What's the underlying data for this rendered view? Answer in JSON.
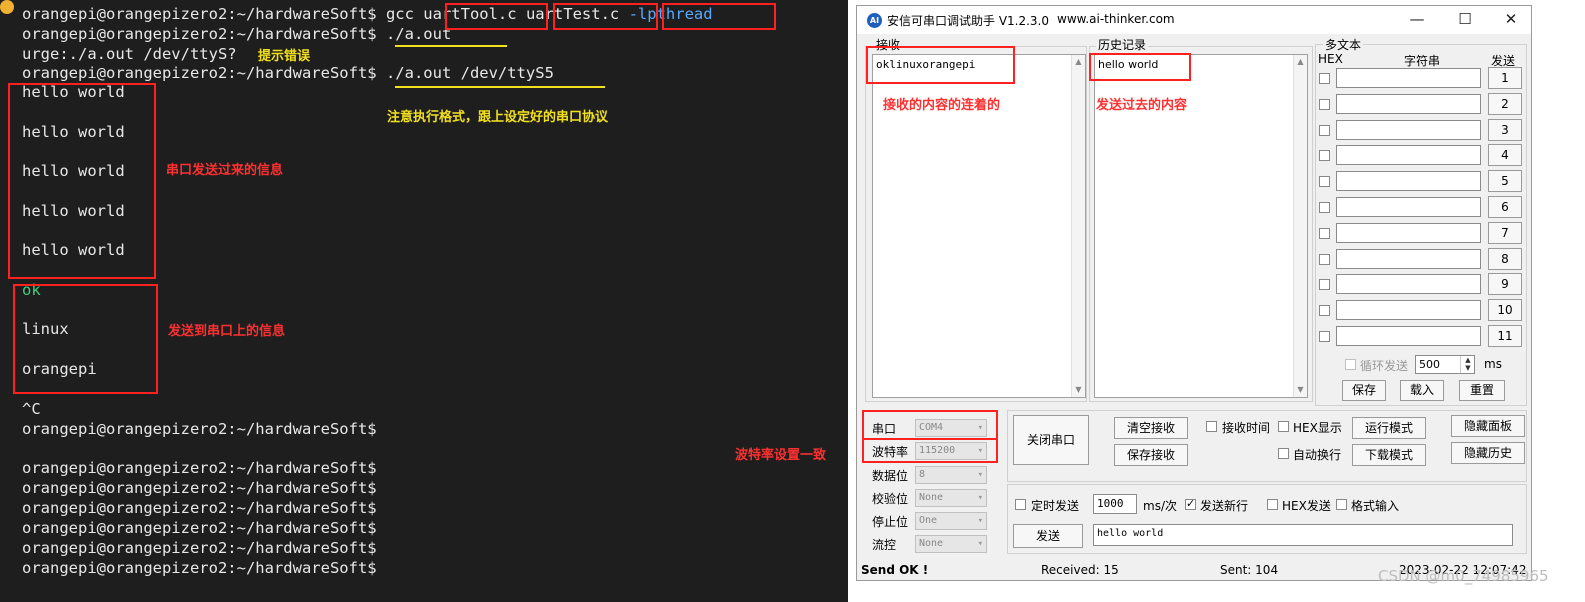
{
  "terminal": {
    "lines": [
      {
        "prompt": "orangepi@orangepizero2:~/hardwareSoft$ ",
        "cmd": "gcc ",
        "a1": "uartTool.c",
        "a2": " uartTest.c",
        "a3": " -lpthread"
      },
      {
        "prompt": "orangepi@orangepizero2:~/hardwareSoft$ ",
        "cmd": "./a.out"
      },
      {
        "text": "urge:./a.out /dev/ttyS?"
      },
      {
        "prompt": "orangepi@orangepizero2:~/hardwareSoft$ ",
        "cmd": "./a.out /dev/ttyS5"
      }
    ],
    "received": [
      "hello world",
      "hello world",
      "hello world",
      "hello world",
      "hello world"
    ],
    "sent": [
      "ok",
      "linux",
      "orangepi"
    ],
    "ctrl_c": "^C",
    "tail_prompts": [
      "orangepi@orangepizero2:~/hardwareSoft$",
      "orangepi@orangepizero2:~/hardwareSoft$",
      "orangepi@orangepizero2:~/hardwareSoft$",
      "orangepi@orangepizero2:~/hardwareSoft$",
      "orangepi@orangepizero2:~/hardwareSoft$",
      "orangepi@orangepizero2:~/hardwareSoft$",
      "orangepi@orangepizero2:~/hardwareSoft$"
    ],
    "annotations": {
      "error_hint": "提示错误",
      "format_note": "注意执行格式，跟上设定好的串口协议",
      "received_note": "串口发送过来的信息",
      "sent_note": "发送到串口上的信息",
      "baud_note": "波特率设置一致"
    }
  },
  "serial_tool": {
    "title": "安信可串口调试助手 V1.2.3.0",
    "url": "www.ai-thinker.com",
    "icon_text": "AI",
    "window_buttons": {
      "minimize": "—",
      "maximize": "☐",
      "close": "✕"
    },
    "receive": {
      "label": "接收",
      "content": "oklinuxorangepi",
      "note": "接收的内容的连着的"
    },
    "history": {
      "label": "历史记录",
      "content": "hello world",
      "note": "发送过去的内容"
    },
    "multitext": {
      "label": "多文本",
      "hex_header": "HEX",
      "string_header": "字符串",
      "send_header": "发送",
      "buttons": [
        "1",
        "2",
        "3",
        "4",
        "5",
        "6",
        "7",
        "8",
        "9",
        "10",
        "11"
      ],
      "loop_send": "循环发送",
      "interval": "500",
      "interval_unit": "ms",
      "save": "保存",
      "load": "载入",
      "reset": "重置"
    },
    "port_settings": {
      "port_label": "串口",
      "port_value": "COM4",
      "baud_label": "波特率",
      "baud_value": "115200",
      "databits_label": "数据位",
      "databits_value": "8",
      "parity_label": "校验位",
      "parity_value": "None",
      "stopbits_label": "停止位",
      "stopbits_value": "One",
      "flow_label": "流控",
      "flow_value": "None"
    },
    "controls": {
      "close_port": "关闭串口",
      "clear_receive": "清空接收",
      "save_receive": "保存接收",
      "receive_time": "接收时间",
      "hex_display": "HEX显示",
      "run_mode": "运行模式",
      "hide_panel": "隐藏面板",
      "auto_newline": "自动换行",
      "download_mode": "下载模式",
      "hide_history": "隐藏历史",
      "timed_send": "定时发送",
      "timed_interval": "1000",
      "timed_unit": "ms/次",
      "send_newline": "发送新行",
      "hex_send": "HEX发送",
      "format_input": "格式输入",
      "send_button": "发送",
      "send_text": "hello world"
    },
    "status": {
      "send_ok": "Send OK !",
      "received": "Received: 15",
      "sent": "Sent: 104",
      "datetime": "2023-02-22 12:07:42"
    }
  },
  "watermark": "CSDN @m0_74985965"
}
